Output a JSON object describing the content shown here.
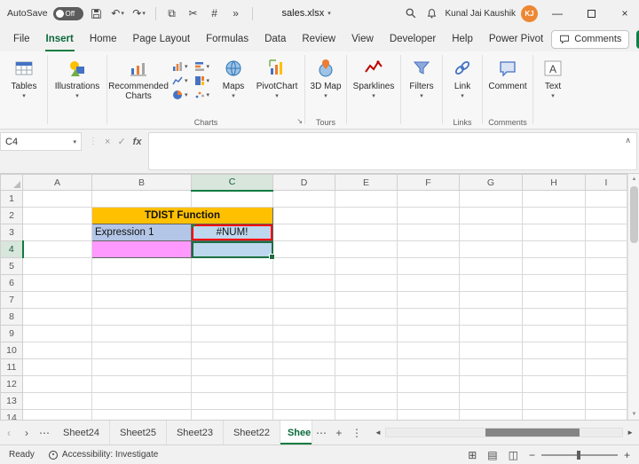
{
  "colors": {
    "accent_green": "#107C41",
    "title_fill": "#FFC000",
    "expression_fill": "#B4C6E7",
    "error_fill": "#BDD7EE",
    "pink_fill": "#FF99FF",
    "highlight_red": "#FF0000"
  },
  "titlebar": {
    "autosave_label": "AutoSave",
    "autosave_state": "Off",
    "filename": "sales.xlsx",
    "user_name": "Kunal Jai Kaushik",
    "user_initials": "KJ"
  },
  "ribbon": {
    "tabs": [
      {
        "label": "File",
        "active": false
      },
      {
        "label": "Insert",
        "active": true
      },
      {
        "label": "Home",
        "active": false
      },
      {
        "label": "Page Layout",
        "active": false
      },
      {
        "label": "Formulas",
        "active": false
      },
      {
        "label": "Data",
        "active": false
      },
      {
        "label": "Review",
        "active": false
      },
      {
        "label": "View",
        "active": false
      },
      {
        "label": "Developer",
        "active": false
      },
      {
        "label": "Help",
        "active": false
      },
      {
        "label": "Power Pivot",
        "active": false
      }
    ],
    "comments_button": "Comments",
    "buttons": {
      "tables": "Tables",
      "illustrations": "Illustrations",
      "recommended_charts": "Recommended\nCharts",
      "maps": "Maps",
      "pivotchart": "PivotChart",
      "map_3d": "3D Map",
      "sparklines": "Sparklines",
      "filters": "Filters",
      "link": "Link",
      "comment": "Comment",
      "text": "Text"
    },
    "group_labels": {
      "charts": "Charts",
      "tours": "Tours",
      "links": "Links",
      "comments": "Comments"
    }
  },
  "formula_bar": {
    "name_box_value": "C4",
    "fx_label": "fx",
    "formula_value": ""
  },
  "grid": {
    "column_headers": [
      "A",
      "B",
      "C",
      "D",
      "E",
      "F",
      "G",
      "H",
      "I"
    ],
    "row_count": 14,
    "selected_column": "C",
    "selected_row": 4,
    "selected_cell": "C4",
    "cells": [
      {
        "ref": "B2",
        "text": "TDIST Function",
        "colspan": 2,
        "bg": "#FFC000",
        "bold": true,
        "align": "center",
        "boxed": true
      },
      {
        "ref": "B3",
        "text": "Expression 1",
        "bg": "#B4C6E7",
        "align": "left",
        "boxed": true
      },
      {
        "ref": "C3",
        "text": "#NUM!",
        "bg": "#BDD7EE",
        "align": "center",
        "boxed": true,
        "red_highlight": true,
        "error_mark": true
      },
      {
        "ref": "B4",
        "text": "",
        "bg": "#FF99FF",
        "boxed": true
      },
      {
        "ref": "C4",
        "text": "",
        "bg": "#BDD7EE",
        "boxed": true,
        "selected": true
      }
    ]
  },
  "sheet_bar": {
    "tabs": [
      {
        "label": "Sheet24",
        "active": false
      },
      {
        "label": "Sheet25",
        "active": false
      },
      {
        "label": "Sheet23",
        "active": false
      },
      {
        "label": "Sheet22",
        "active": false
      },
      {
        "label": "Shee",
        "active": true
      }
    ]
  },
  "status_bar": {
    "ready_label": "Ready",
    "accessibility_label": "Accessibility: Investigate"
  },
  "icons": {
    "undo": "↶",
    "redo": "↷",
    "chevron_down": "▾",
    "more": "»",
    "copy": "⧉",
    "cut": "✂",
    "number": "#",
    "close": "×",
    "minimize": "—",
    "check": "✓",
    "cancel": "×",
    "up_chevron": "∧",
    "ellipsis": "⋯",
    "vertical_dots": "⋮",
    "plus": "+",
    "nav_left": "‹",
    "nav_right": "›",
    "scroll_left": "◄",
    "scroll_right": "►",
    "up_arrow": "▲",
    "down_arrow": "▼",
    "launcher": "↘",
    "view_normal": "⊞",
    "view_layout": "▤",
    "view_break": "◫",
    "zoom_out": "−",
    "zoom_in": "+"
  }
}
